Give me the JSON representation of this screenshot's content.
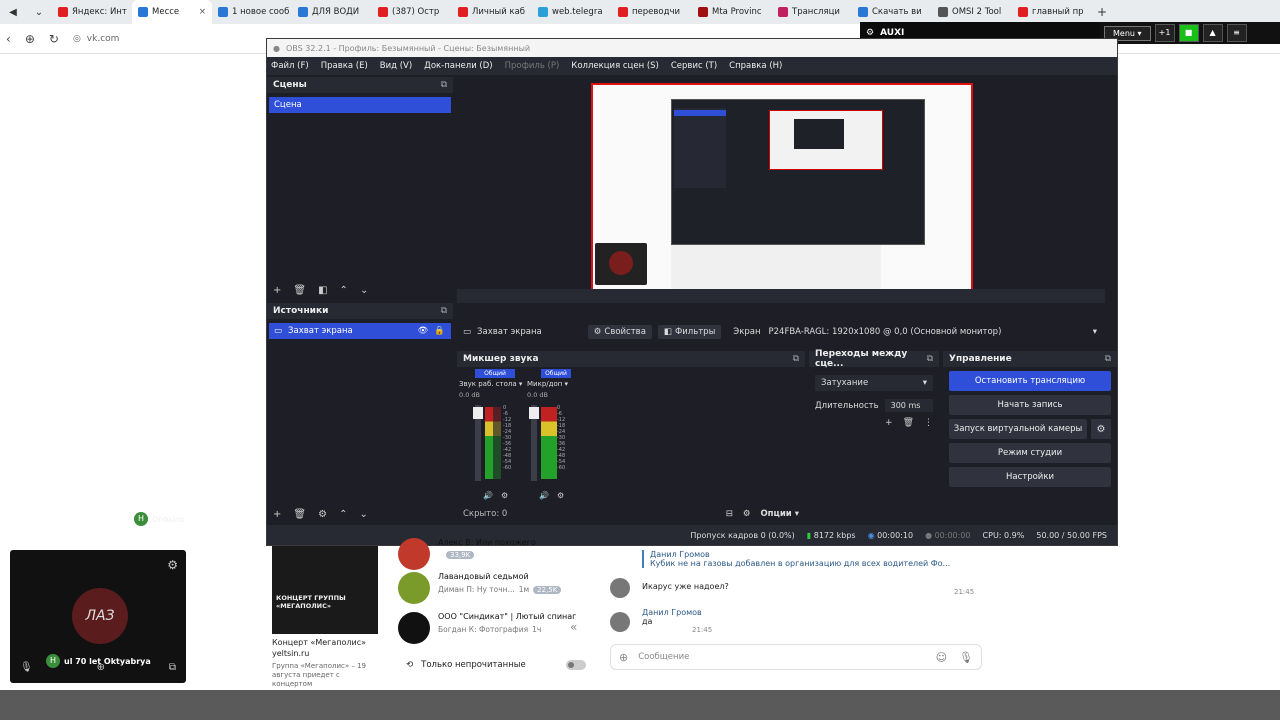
{
  "browser": {
    "tabs": [
      {
        "label": "Яндекс: Инт",
        "color": "#e02020"
      },
      {
        "label": "Мессе",
        "color": "#2a78d6",
        "active": true
      },
      {
        "label": "1 новое сооб",
        "color": "#2a78d6"
      },
      {
        "label": "ДЛЯ ВОДИ",
        "color": "#2a78d6"
      },
      {
        "label": "(387) Остр",
        "color": "#e02020"
      },
      {
        "label": "Личный каб",
        "color": "#e02020"
      },
      {
        "label": "web.telegra",
        "color": "#2aa0d6"
      },
      {
        "label": "переводчи",
        "color": "#e02020"
      },
      {
        "label": "Mta Provinc",
        "color": "#a01010"
      },
      {
        "label": "Трансляци",
        "color": "#c02060"
      },
      {
        "label": "Скачать ви",
        "color": "#2a78d6"
      },
      {
        "label": "OMSI 2 Tool",
        "color": "#555555"
      },
      {
        "label": "главный пр",
        "color": "#e02020"
      }
    ],
    "address": "vk.com"
  },
  "overlay": {
    "channel": "AUXI",
    "menu_label": "Menu",
    "plus_label": "+1"
  },
  "obs": {
    "title": "OBS 32.2.1 - Профиль: Безымянный - Сцены: Безымянный",
    "menu": [
      "Файл (F)",
      "Правка (E)",
      "Вид (V)",
      "Док-панели (D)",
      "Профиль (P)",
      "Коллекция сцен (S)",
      "Сервис (T)",
      "Справка (H)"
    ],
    "scenes": {
      "title": "Сцены",
      "items": [
        "Сцена"
      ]
    },
    "sources": {
      "title": "Источники",
      "items": [
        "Захват экрана"
      ]
    },
    "source_bar": {
      "name": "Захват экрана",
      "properties": "Свойства",
      "filters": "Фильтры",
      "screen_label": "Экран",
      "screen_value": "P24FBA-RAGL: 1920x1080 @ 0,0 (Основной монитор)"
    },
    "mixer": {
      "title": "Микшер звука",
      "tracks": [
        {
          "tag": "Общий",
          "name": "Звук раб. стола",
          "db": "0.0 dB"
        },
        {
          "tag": "Общий",
          "name": "Микр/доп",
          "db": "0.0 dB"
        }
      ],
      "ticks": [
        "0",
        "-6",
        "-12",
        "-18",
        "-24",
        "-30",
        "-36",
        "-42",
        "-48",
        "-54",
        "-60"
      ],
      "hidden": "Скрыто: 0",
      "options": "Опции"
    },
    "transitions": {
      "title": "Переходы между сце...",
      "type": "Затухание",
      "duration_label": "Длительность",
      "duration_value": "300 ms"
    },
    "controls": {
      "title": "Управление",
      "stop_stream": "Остановить трансляцию",
      "start_record": "Начать запись",
      "virtual_cam": "Запуск виртуальной камеры",
      "studio_mode": "Режим студии",
      "settings": "Настройки"
    },
    "status": {
      "dropped": "Пропуск кадров 0 (0.0%)",
      "bitrate": "8172 kbps",
      "stream_time": "00:00:10",
      "rec_time": "00:00:00",
      "cpu": "CPU: 0.9%",
      "fps": "50.00 / 50.00 FPS"
    }
  },
  "cam": {
    "top_user": "Onoxino",
    "caption": "ul 70 let Oktyabrya",
    "logo": "ЛАЗ"
  },
  "vk_post": {
    "image_text": "КОНЦЕРТ ГРУППЫ «МЕГАПОЛИС»",
    "title": "Концерт «Мегаполис»",
    "site": "yeltsin.ru",
    "desc": "Группа «Мегаполис» – 19 августа приедет с концертом"
  },
  "chats": [
    {
      "title": "Алекс В: Или похожего",
      "sub": "",
      "time": "",
      "badge": "33,9K",
      "color": "#c0392b"
    },
    {
      "title": "Лавандовый седьмой",
      "sub": "Диман П: Ну точн...",
      "time": "1м",
      "badge": "22,5K",
      "color": "#7a9a2a"
    },
    {
      "title": "ООО \"Синдикат\" | Лютый спинаг",
      "sub": "Богдан К: Фотография",
      "time": "1ч",
      "badge": "",
      "color": "#111111"
    }
  ],
  "unread_only": "Только непрочитанные",
  "dialog": {
    "quote_author": "Данил Громов",
    "quote_text": "Кубик не на газовы добавлен в организацию для всех водителей Фо...",
    "msg1": "Икарус уже надоел?",
    "msg1_time": "21:45",
    "msg2_author": "Данил Громов",
    "msg2": "да",
    "msg2_time": "21:45",
    "input_placeholder": "Сообщение"
  }
}
